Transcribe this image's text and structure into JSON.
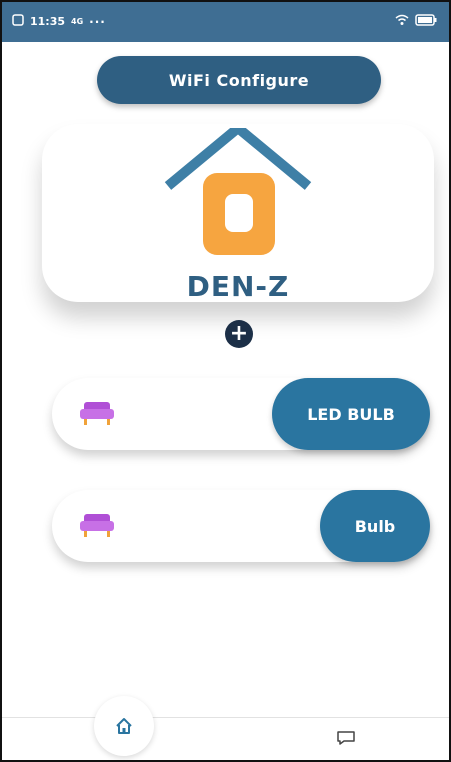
{
  "status_bar": {
    "time": "11:35",
    "network_label": "4G",
    "more": "···"
  },
  "header": {
    "wifi_button_label": "WiFi Configure"
  },
  "brand": {
    "name": "DEN-Z",
    "icon": "house-logo"
  },
  "actions": {
    "add_icon": "plus-icon"
  },
  "devices": [
    {
      "label": "LED BULB",
      "icon": "sofa-icon"
    },
    {
      "label": "Bulb",
      "icon": "sofa-icon"
    }
  ],
  "bottom_nav": {
    "items": [
      "home-icon",
      "chat-icon"
    ]
  },
  "colors": {
    "primary": "#2f5f82",
    "accent_button": "#2a75a0",
    "logo_orange": "#f6a540",
    "roof_blue": "#3e7fa6",
    "sofa_purple": "#b04fd6"
  }
}
